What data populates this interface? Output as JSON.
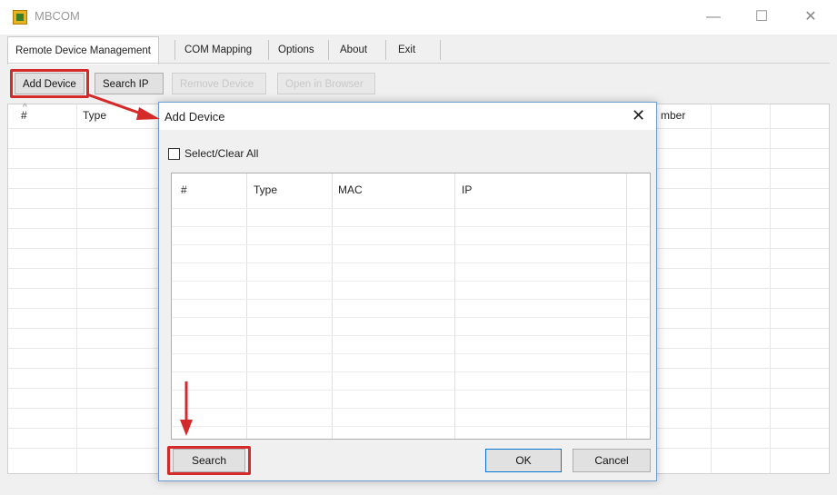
{
  "window": {
    "title": "MBCOM",
    "controls": {
      "minimize": "—",
      "maximize": "☐",
      "close": "✕"
    }
  },
  "tabs": [
    {
      "label": "Remote Device Management",
      "active": true
    },
    {
      "label": "COM Mapping"
    },
    {
      "label": "Options"
    },
    {
      "label": "About"
    },
    {
      "label": "Exit"
    }
  ],
  "toolbar": {
    "add_device": "Add Device",
    "search_ip": "Search IP",
    "remove_device": "Remove Device",
    "open_in_browser": "Open in Browser"
  },
  "main_table": {
    "columns": [
      "#",
      "Type",
      "mber"
    ]
  },
  "dialog": {
    "title": "Add Device",
    "close": "✕",
    "select_clear_all": "Select/Clear All",
    "columns": [
      "#",
      "Type",
      "MAC",
      "IP"
    ],
    "search_button": "Search",
    "ok_button": "OK",
    "cancel_button": "Cancel"
  },
  "annotation_color": "#d42a2a"
}
